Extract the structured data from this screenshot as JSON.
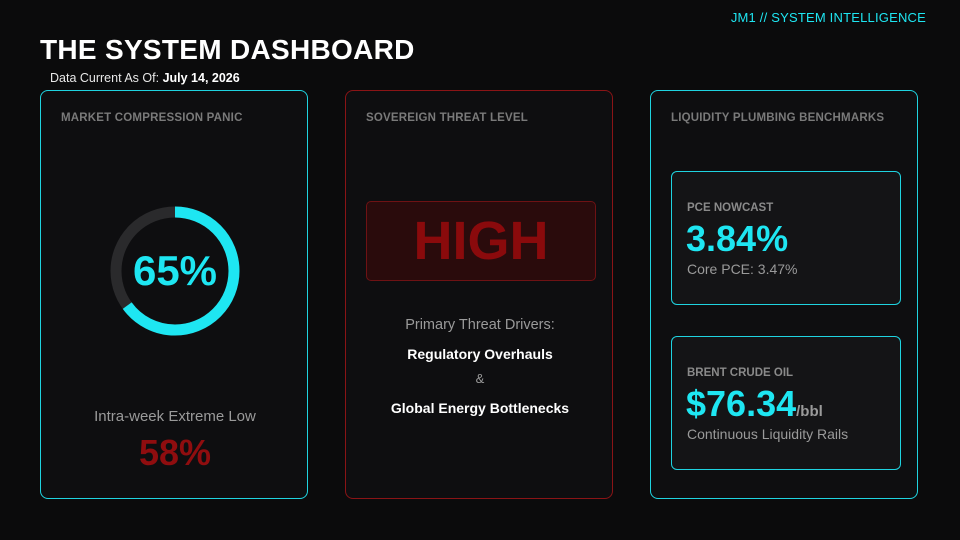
{
  "header": {
    "brand": "JM1 // SYSTEM INTELLIGENCE",
    "title": "THE SYSTEM DASHBOARD",
    "as_of_label": "Data Current As Of:",
    "as_of_date": "July 14, 2026"
  },
  "market_panic": {
    "title": "MARKET COMPRESSION PANIC",
    "value_label": "65%",
    "value_fraction": 0.65,
    "low_label": "Intra-week Extreme Low",
    "low_value": "58%"
  },
  "threat": {
    "title": "SOVEREIGN THREAT LEVEL",
    "level": "HIGH",
    "drivers_label": "Primary Threat Drivers:",
    "driver_1": "Regulatory Overhauls",
    "separator": "&",
    "driver_2": "Global Energy Bottlenecks"
  },
  "liquidity": {
    "title": "LIQUIDITY PLUMBING BENCHMARKS",
    "pce": {
      "label": "PCE NOWCAST",
      "value": "3.84%",
      "sub": "Core PCE: 3.47%"
    },
    "brent": {
      "label": "BRENT CRUDE OIL",
      "value": "$76.34",
      "unit": "/bbl",
      "sub": "Continuous Liquidity Rails"
    }
  },
  "colors": {
    "accent_cyan": "#1ee6f2",
    "threat_red": "#8a0a0c",
    "background": "#0b0b0c"
  }
}
